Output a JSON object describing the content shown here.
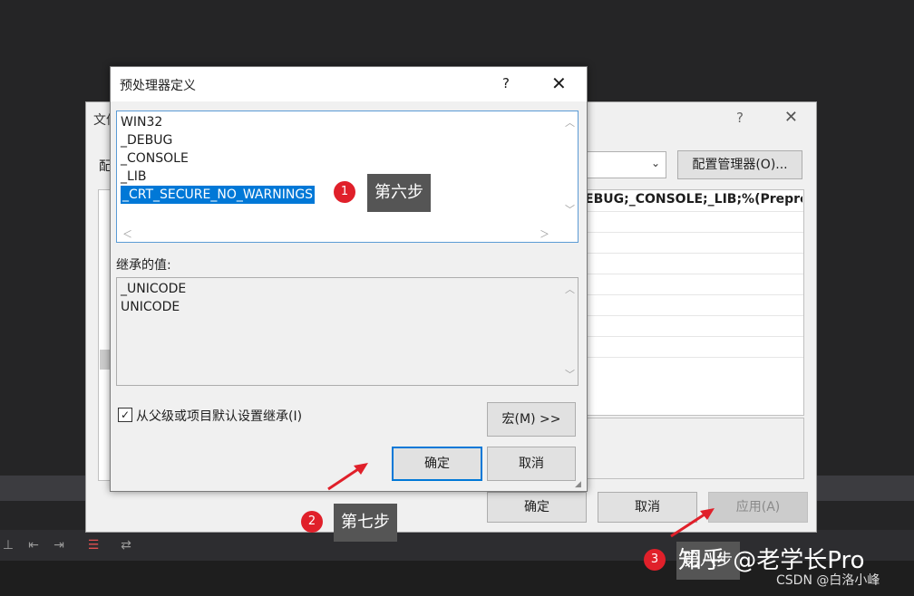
{
  "property_dialog": {
    "title": "文件",
    "config_label": "配",
    "config_manager_label": "配置管理器(O)...",
    "help": "?",
    "close": "✕",
    "value_text": "EBUG;_CONSOLE;_LIB;%(Preproc",
    "ok_label": "确定",
    "cancel_label": "取消",
    "apply_label": "应用(A)"
  },
  "preprocessor_dialog": {
    "title": "预处理器定义",
    "help": "?",
    "close": "✕",
    "definitions": [
      "WIN32",
      "_DEBUG",
      "_CONSOLE",
      "_LIB"
    ],
    "selected_definition": "_CRT_SECURE_NO_WARNINGS",
    "inherited_label": "继承的值:",
    "inherited_values": [
      "_UNICODE",
      "UNICODE"
    ],
    "inherit_checkbox_label": "从父级或项目默认设置继承(I)",
    "inherit_checked": true,
    "macro_button_label": "宏(M) >>",
    "ok_label": "确定",
    "cancel_label": "取消"
  },
  "annotations": {
    "step1_number": "1",
    "step1_text": "第六步",
    "step2_number": "2",
    "step2_text": "第七步",
    "step3_number": "3",
    "step3_text": "第八步",
    "arrow_color": "#e0202a"
  },
  "watermarks": {
    "zhihu": "知乎 @老学长Pro",
    "csdn": "CSDN @白洛小峰"
  }
}
